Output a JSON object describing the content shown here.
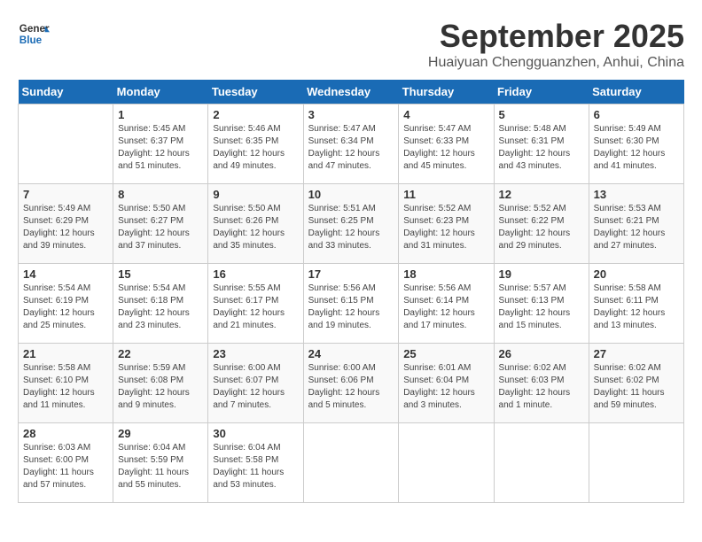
{
  "header": {
    "logo_line1": "General",
    "logo_line2": "Blue",
    "month": "September 2025",
    "location": "Huaiyuan Chengguanzhen, Anhui, China"
  },
  "days_of_week": [
    "Sunday",
    "Monday",
    "Tuesday",
    "Wednesday",
    "Thursday",
    "Friday",
    "Saturday"
  ],
  "weeks": [
    [
      {
        "day": "",
        "info": ""
      },
      {
        "day": "1",
        "info": "Sunrise: 5:45 AM\nSunset: 6:37 PM\nDaylight: 12 hours\nand 51 minutes."
      },
      {
        "day": "2",
        "info": "Sunrise: 5:46 AM\nSunset: 6:35 PM\nDaylight: 12 hours\nand 49 minutes."
      },
      {
        "day": "3",
        "info": "Sunrise: 5:47 AM\nSunset: 6:34 PM\nDaylight: 12 hours\nand 47 minutes."
      },
      {
        "day": "4",
        "info": "Sunrise: 5:47 AM\nSunset: 6:33 PM\nDaylight: 12 hours\nand 45 minutes."
      },
      {
        "day": "5",
        "info": "Sunrise: 5:48 AM\nSunset: 6:31 PM\nDaylight: 12 hours\nand 43 minutes."
      },
      {
        "day": "6",
        "info": "Sunrise: 5:49 AM\nSunset: 6:30 PM\nDaylight: 12 hours\nand 41 minutes."
      }
    ],
    [
      {
        "day": "7",
        "info": "Sunrise: 5:49 AM\nSunset: 6:29 PM\nDaylight: 12 hours\nand 39 minutes."
      },
      {
        "day": "8",
        "info": "Sunrise: 5:50 AM\nSunset: 6:27 PM\nDaylight: 12 hours\nand 37 minutes."
      },
      {
        "day": "9",
        "info": "Sunrise: 5:50 AM\nSunset: 6:26 PM\nDaylight: 12 hours\nand 35 minutes."
      },
      {
        "day": "10",
        "info": "Sunrise: 5:51 AM\nSunset: 6:25 PM\nDaylight: 12 hours\nand 33 minutes."
      },
      {
        "day": "11",
        "info": "Sunrise: 5:52 AM\nSunset: 6:23 PM\nDaylight: 12 hours\nand 31 minutes."
      },
      {
        "day": "12",
        "info": "Sunrise: 5:52 AM\nSunset: 6:22 PM\nDaylight: 12 hours\nand 29 minutes."
      },
      {
        "day": "13",
        "info": "Sunrise: 5:53 AM\nSunset: 6:21 PM\nDaylight: 12 hours\nand 27 minutes."
      }
    ],
    [
      {
        "day": "14",
        "info": "Sunrise: 5:54 AM\nSunset: 6:19 PM\nDaylight: 12 hours\nand 25 minutes."
      },
      {
        "day": "15",
        "info": "Sunrise: 5:54 AM\nSunset: 6:18 PM\nDaylight: 12 hours\nand 23 minutes."
      },
      {
        "day": "16",
        "info": "Sunrise: 5:55 AM\nSunset: 6:17 PM\nDaylight: 12 hours\nand 21 minutes."
      },
      {
        "day": "17",
        "info": "Sunrise: 5:56 AM\nSunset: 6:15 PM\nDaylight: 12 hours\nand 19 minutes."
      },
      {
        "day": "18",
        "info": "Sunrise: 5:56 AM\nSunset: 6:14 PM\nDaylight: 12 hours\nand 17 minutes."
      },
      {
        "day": "19",
        "info": "Sunrise: 5:57 AM\nSunset: 6:13 PM\nDaylight: 12 hours\nand 15 minutes."
      },
      {
        "day": "20",
        "info": "Sunrise: 5:58 AM\nSunset: 6:11 PM\nDaylight: 12 hours\nand 13 minutes."
      }
    ],
    [
      {
        "day": "21",
        "info": "Sunrise: 5:58 AM\nSunset: 6:10 PM\nDaylight: 12 hours\nand 11 minutes."
      },
      {
        "day": "22",
        "info": "Sunrise: 5:59 AM\nSunset: 6:08 PM\nDaylight: 12 hours\nand 9 minutes."
      },
      {
        "day": "23",
        "info": "Sunrise: 6:00 AM\nSunset: 6:07 PM\nDaylight: 12 hours\nand 7 minutes."
      },
      {
        "day": "24",
        "info": "Sunrise: 6:00 AM\nSunset: 6:06 PM\nDaylight: 12 hours\nand 5 minutes."
      },
      {
        "day": "25",
        "info": "Sunrise: 6:01 AM\nSunset: 6:04 PM\nDaylight: 12 hours\nand 3 minutes."
      },
      {
        "day": "26",
        "info": "Sunrise: 6:02 AM\nSunset: 6:03 PM\nDaylight: 12 hours\nand 1 minute."
      },
      {
        "day": "27",
        "info": "Sunrise: 6:02 AM\nSunset: 6:02 PM\nDaylight: 11 hours\nand 59 minutes."
      }
    ],
    [
      {
        "day": "28",
        "info": "Sunrise: 6:03 AM\nSunset: 6:00 PM\nDaylight: 11 hours\nand 57 minutes."
      },
      {
        "day": "29",
        "info": "Sunrise: 6:04 AM\nSunset: 5:59 PM\nDaylight: 11 hours\nand 55 minutes."
      },
      {
        "day": "30",
        "info": "Sunrise: 6:04 AM\nSunset: 5:58 PM\nDaylight: 11 hours\nand 53 minutes."
      },
      {
        "day": "",
        "info": ""
      },
      {
        "day": "",
        "info": ""
      },
      {
        "day": "",
        "info": ""
      },
      {
        "day": "",
        "info": ""
      }
    ]
  ]
}
